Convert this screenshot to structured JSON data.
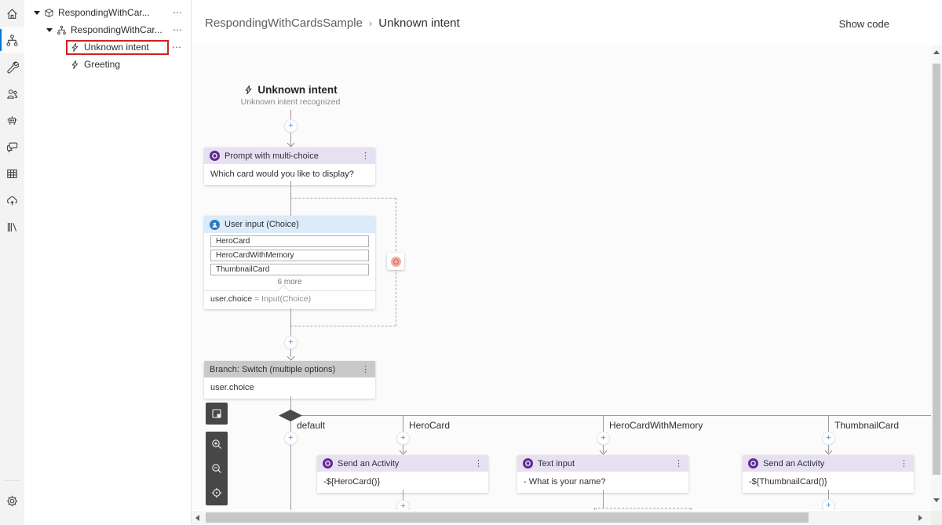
{
  "glyphs": {
    "plus": "+",
    "kebab": "⋮",
    "ellipsis": "⋯",
    "breadcrumb_sep": "›"
  },
  "colors": {
    "accent_blue": "#0078d4",
    "activity_purple": "#5c2d91",
    "activity_header": "#e7e0f3",
    "user_input_blue": "#2e7cc6",
    "user_input_header": "#dcebf9",
    "switch_header": "#c9c9c9",
    "selection_red": "#cc2222"
  },
  "rail": {
    "items": [
      "home",
      "design-flow",
      "wrench",
      "user-group",
      "robot",
      "chat",
      "table",
      "cloud-upload",
      "library"
    ],
    "selected_index": 1,
    "bottom": "settings-gear"
  },
  "tree": {
    "items": [
      {
        "label": "RespondingWithCar...",
        "icon": "project-cube",
        "expanded": true,
        "overflow": "⋯"
      },
      {
        "label": "RespondingWithCar...",
        "icon": "dialog-flow",
        "expanded": true,
        "overflow": "⋯"
      },
      {
        "label": "Unknown intent",
        "icon": "trigger-bolt",
        "selected": true,
        "overflow": "⋯"
      },
      {
        "label": "Greeting",
        "icon": "trigger-bolt",
        "selected": false
      }
    ]
  },
  "header": {
    "breadcrumb": {
      "parent": "RespondingWithCardsSample",
      "separator": "›",
      "current": "Unknown intent"
    },
    "show_code": "Show code"
  },
  "canvas": {
    "trigger": {
      "title": "Unknown intent",
      "subtitle": "Unknown intent recognized"
    },
    "prompt_node": {
      "title": "Prompt with multi-choice",
      "body": "Which card would you like to display?"
    },
    "user_input_node": {
      "title": "User input (Choice)",
      "choices": [
        "HeroCard",
        "HeroCardWithMemory",
        "ThumbnailCard"
      ],
      "more_label": "6 more",
      "result_lhs": "user.choice",
      "result_rhs": "= Input(Choice)"
    },
    "switch_node": {
      "title": "Branch: Switch (multiple options)",
      "body": "user.choice"
    },
    "branches": [
      {
        "label": "default"
      },
      {
        "label": "HeroCard",
        "node": {
          "title": "Send an Activity",
          "body": "-${HeroCard()}"
        }
      },
      {
        "label": "HeroCardWithMemory",
        "node": {
          "title": "Text input",
          "body": "- What is your name?"
        }
      },
      {
        "label": "ThumbnailCard",
        "node": {
          "title": "Send an Activity",
          "body": "-${ThumbnailCard()}"
        }
      }
    ],
    "controls": [
      "minimap",
      "zoom-in",
      "zoom-out",
      "focus"
    ]
  }
}
